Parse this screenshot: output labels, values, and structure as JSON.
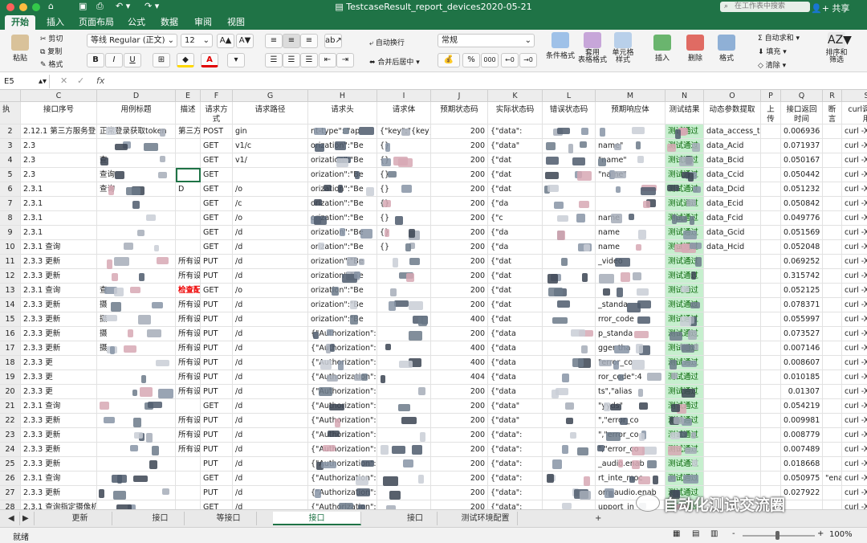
{
  "window": {
    "title": "TestcaseResult_report_devices2020-05-21",
    "search_placeholder": "在工作表中搜索",
    "share": "共享"
  },
  "ribbon_tabs": [
    "开始",
    "插入",
    "页面布局",
    "公式",
    "数据",
    "审阅",
    "视图"
  ],
  "ribbon": {
    "paste": "粘贴",
    "cut": "剪切",
    "copy": "复制",
    "format_painter": "格式",
    "font_name": "等线 Regular (正文)",
    "font_size": "12",
    "bold": "B",
    "italic": "I",
    "underline": "U",
    "wrap": "自动换行",
    "merge": "合并后居中",
    "number_format": "常规",
    "percent": "%",
    "comma": "000",
    "cond_format": "条件格式",
    "table_format": "套用\n表格格式",
    "cell_styles": "单元格\n样式",
    "insert": "插入",
    "delete": "删除",
    "format": "格式",
    "autosum": "自动求和",
    "fill": "填充",
    "clear": "清除",
    "sort_filter": "排序和\n筛选"
  },
  "formula_bar": {
    "name_box": "E5",
    "fx": "fx",
    "value": ""
  },
  "columns": [
    {
      "letter": "",
      "title": ""
    },
    {
      "letter": "C",
      "title": "接口序号"
    },
    {
      "letter": "D",
      "title": "用例标题"
    },
    {
      "letter": "E",
      "title": "描述"
    },
    {
      "letter": "F",
      "title": "请求方式"
    },
    {
      "letter": "G",
      "title": "请求路径"
    },
    {
      "letter": "H",
      "title": "请求头"
    },
    {
      "letter": "I",
      "title": "请求体"
    },
    {
      "letter": "J",
      "title": "预期状态码"
    },
    {
      "letter": "K",
      "title": "实际状态码"
    },
    {
      "letter": "L",
      "title": "错误状态码"
    },
    {
      "letter": "M",
      "title": "预期响应体"
    },
    {
      "letter": "N",
      "title": "测试结果"
    },
    {
      "letter": "O",
      "title": "动态参数提取"
    },
    {
      "letter": "P",
      "title": "上传下载文件"
    },
    {
      "letter": "Q",
      "title": "接口返回时间"
    },
    {
      "letter": "R",
      "title": "断言异常提示"
    },
    {
      "letter": "S",
      "title": "curl调试使用"
    }
  ],
  "first_header_cell": "执",
  "rows": [
    {
      "n": "2",
      "c": "2.12.1 第三方服务登录",
      "d": "正常登录获取token",
      "e": "第三方",
      "f": "POST",
      "g": "gin",
      "h": "nt-type\": \"ap",
      "i": "{\"key\":\"{key}\",\"se",
      "j": "200",
      "k": "{\"data\":",
      "l": "",
      "m": "",
      "nres": "测试通过",
      "o": "data_access_token",
      "q": "0.006936",
      "s": "curl -X POST -"
    },
    {
      "n": "3",
      "c": "2.3",
      "d": "",
      "e": "",
      "f": "GET",
      "g": "v1/c",
      "h": "orization\":\"Be",
      "i": "{}",
      "j": "200",
      "k": "{\"data\"",
      "m": "name\"",
      "nres": "测试通过",
      "o": "data_Acid",
      "q": "0.071937",
      "s": "curl -X GET -H"
    },
    {
      "n": "4",
      "c": "2.3",
      "d": "查",
      "e": "",
      "f": "GET",
      "g": "v1/",
      "h": "orization\":\"Be",
      "i": "{}",
      "j": "200",
      "k": "{\"dat",
      "m": "\"name\"",
      "nres": "测试通过",
      "o": "data_Bcid",
      "q": "0.050167",
      "s": "curl -X GET -H"
    },
    {
      "n": "5",
      "c": "2.3",
      "d": "查询",
      "e": "",
      "f": "GET",
      "g": "",
      "h": "orization\":\"Be",
      "i": "{}",
      "j": "200",
      "k": "{\"dat",
      "m": "\"name\"",
      "nres": "测试通过",
      "o": "data_Ccid",
      "q": "0.050442",
      "s": "curl -X GET -H"
    },
    {
      "n": "6",
      "c": "2.3.1",
      "d": "查询",
      "e": "D",
      "f": "GET",
      "g": "/o",
      "h": "orization\":\"Be",
      "i": "{}",
      "j": "200",
      "k": "{\"dat",
      "m": "",
      "nres": "测试通过",
      "o": "data_Dcid",
      "q": "0.051232",
      "s": "curl -X GET -H"
    },
    {
      "n": "7",
      "c": "2.3.1",
      "d": "",
      "e": "",
      "f": "GET",
      "g": "/c",
      "h": "orization\":\"Be",
      "i": "{}",
      "j": "200",
      "k": "{\"da",
      "m": "",
      "nres": "测试通过",
      "o": "data_Ecid",
      "q": "0.050842",
      "s": "curl -X GET -H"
    },
    {
      "n": "8",
      "c": "2.3.1",
      "d": "",
      "e": "",
      "f": "GET",
      "g": "/o",
      "h": "orization\":\"Be",
      "i": "{}",
      "j": "200",
      "k": "{\"c",
      "m": "name",
      "nres": "测试通过",
      "o": "data_Fcid",
      "q": "0.049776",
      "s": "curl -X GET -H"
    },
    {
      "n": "9",
      "c": "2.3.1",
      "d": "",
      "e": "",
      "f": "GET",
      "g": "/d",
      "h": "orization\":\"Be",
      "i": "{}",
      "j": "200",
      "k": "{\"da",
      "m": "name",
      "nres": "测试通过",
      "o": "data_Gcid",
      "q": "0.051569",
      "s": "curl -X GET -H"
    },
    {
      "n": "10",
      "c": "2.3.1 查询",
      "d": "",
      "e": "",
      "f": "GET",
      "g": "/d",
      "h": "orization\":\"Be",
      "i": "{}",
      "j": "200",
      "k": "{\"da",
      "m": "name",
      "nres": "测试通过",
      "o": "data_Hcid",
      "q": "0.052048",
      "s": "curl -X GET -H"
    },
    {
      "n": "11",
      "c": "2.3.3 更新",
      "d": "",
      "e": "所有设",
      "f": "PUT",
      "g": "/d",
      "h": "orization\":\"Be",
      "i": "",
      "j": "200",
      "k": "{\"dat",
      "m": "_video",
      "nres": "测试通过",
      "o": "",
      "q": "0.069252",
      "s": "curl -X PUT -H"
    },
    {
      "n": "12",
      "c": "2.3.3 更新",
      "d": "",
      "e": "所有设",
      "f": "PUT",
      "g": "/d",
      "h": "orization\":\"Be",
      "i": "",
      "j": "200",
      "k": "{\"dat",
      "m": "",
      "nres": "测试通过",
      "o": "",
      "q": "0.315742",
      "s": "curl -X PUT -H"
    },
    {
      "n": "13",
      "c": "2.3.1 查询",
      "d": "查",
      "e": "检查配置",
      "f": "GET",
      "g": "/o",
      "h": "orization\":\"Be",
      "i": "",
      "j": "200",
      "k": "{\"dat",
      "m": "",
      "nres": "测试通过",
      "o": "",
      "q": "0.052125",
      "s": "curl -X GET -H"
    },
    {
      "n": "14",
      "c": "2.3.3 更新",
      "d": "摄",
      "e": "所有设",
      "f": "PUT",
      "g": "/d",
      "h": "orization\":\"Be",
      "i": "",
      "j": "200",
      "k": "{\"dat",
      "m": "_standa",
      "nres": "测试通过",
      "o": "",
      "q": "0.078371",
      "s": "curl -X PUT -H"
    },
    {
      "n": "15",
      "c": "2.3.3 更新",
      "d": "摄",
      "e": "所有设",
      "f": "PUT",
      "g": "/d",
      "h": "orization\":\"Be",
      "i": "",
      "j": "400",
      "k": "{\"dat",
      "m": "rror_code",
      "nres": "测试通过",
      "o": "",
      "q": "0.055997",
      "s": "curl -X PUT -H"
    },
    {
      "n": "16",
      "c": "2.3.3 更新",
      "d": "摄",
      "e": "所有设",
      "f": "PUT",
      "g": "/d",
      "h": "{\"Authorization\":\"B",
      "i": "",
      "j": "200",
      "k": "{\"data",
      "m": "p_standa",
      "nres": "测试通过",
      "o": "",
      "q": "0.073527",
      "s": "curl -X PUT -H"
    },
    {
      "n": "17",
      "c": "2.3.3 更新",
      "d": "摄",
      "e": "所有设",
      "f": "PUT",
      "g": "/d",
      "h": "{\"Authorization\":\"B",
      "i": "",
      "j": "400",
      "k": "{\"data",
      "m": "gger tha",
      "nres": "测试通过",
      "o": "",
      "q": "0.007146",
      "s": "curl -X PUT -H"
    },
    {
      "n": "18",
      "c": "2.3.3 更",
      "d": "",
      "e": "所有设",
      "f": "PUT",
      "g": "/d",
      "h": "{\"Authorization\":\"B",
      "i": "",
      "j": "400",
      "k": "{\"data",
      "m": "\"error_co",
      "nres": "测试通过",
      "o": "",
      "q": "0.008607",
      "s": "curl -X PUT -H"
    },
    {
      "n": "19",
      "c": "2.3.3 更",
      "d": "",
      "e": "所有设",
      "f": "PUT",
      "g": "/d",
      "h": "{\"Authorization\":\"B",
      "i": "",
      "j": "404",
      "k": "{\"data",
      "m": "ror_code\":4",
      "nres": "测试通过",
      "o": "",
      "q": "0.010185",
      "s": "curl -X PUT -H"
    },
    {
      "n": "20",
      "c": "2.3.3 更",
      "d": "",
      "e": "所有设",
      "f": "PUT",
      "g": "/d",
      "h": "{\"Authorization\":\"B",
      "i": "",
      "j": "200",
      "k": "{\"data",
      "m": "ts\",\"alias",
      "nres": "测试通过",
      "o": "",
      "q": "0.01307",
      "s": "curl -X PUT -H"
    },
    {
      "n": "21",
      "c": "2.3.1 查询",
      "d": "",
      "e": "",
      "f": "GET",
      "g": "/d",
      "h": "{\"Authorization\":\"B",
      "i": "",
      "j": "200",
      "k": "{\"data\"",
      "m": "\"yyds\"",
      "nres": "测试通过",
      "o": "",
      "q": "0.054219",
      "s": "curl -X GET -H"
    },
    {
      "n": "22",
      "c": "2.3.3 更新",
      "d": "",
      "e": "所有设",
      "f": "PUT",
      "g": "/d",
      "h": "{\"Authorization\":\"B",
      "i": "",
      "j": "200",
      "k": "{\"data\"",
      "m": "\",\"error_co",
      "nres": "测试通过",
      "o": "",
      "q": "0.009981",
      "s": "curl -X PUT -H"
    },
    {
      "n": "23",
      "c": "2.3.3 更新",
      "d": "",
      "e": "所有设",
      "f": "PUT",
      "g": "/d",
      "h": "{\"Authorization\":\"B",
      "i": "",
      "j": "200",
      "k": "{\"data\":",
      "m": "\",\"error_co",
      "nres": "测试通过",
      "o": "",
      "q": "0.008779",
      "s": "curl -X PUT -H"
    },
    {
      "n": "24",
      "c": "2.3.3 更新",
      "d": "",
      "e": "所有设",
      "f": "PUT",
      "g": "/d",
      "h": "{\"Authorization\":\"B",
      "i": "",
      "j": "200",
      "k": "{\"data\":",
      "m": "\",\"error_co",
      "nres": "测试通过",
      "o": "",
      "q": "0.007489",
      "s": "curl -X PUT -H"
    },
    {
      "n": "25",
      "c": "2.3.3 更新",
      "d": "",
      "e": "",
      "f": "PUT",
      "g": "/d",
      "h": "{\"Authorization\":\"B",
      "i": "",
      "j": "200",
      "k": "{\"data\":",
      "m": "_audio.enab",
      "nres": "测试通过",
      "o": "",
      "q": "0.018668",
      "s": "curl -X PUT -H"
    },
    {
      "n": "26",
      "c": "2.3.1 查询",
      "d": "",
      "e": "",
      "f": "GET",
      "g": "/d",
      "h": "{\"Authorization\":\"B",
      "i": "",
      "j": "200",
      "k": "{\"data\":",
      "m": "rt_inte_moc",
      "nres": "测试通过",
      "o": "",
      "q": "0.050975",
      "r": "\"enab",
      "s": "curl -X GET -H"
    },
    {
      "n": "27",
      "c": "2.3.3 更新",
      "d": "",
      "e": "",
      "f": "PUT",
      "g": "/d",
      "h": "{\"Authorization\":\"B",
      "i": "",
      "j": "200",
      "k": "{\"data\":",
      "m": "om_audio.enab",
      "nres": "测试通过",
      "o": "",
      "q": "0.027922",
      "s": "curl -X PUT -H"
    },
    {
      "n": "28",
      "c": "2.3.1 查询指定摄像机",
      "d": "",
      "e": "",
      "f": "GET",
      "g": "/d",
      "h": "{\"Authorization\":\"B",
      "i": "",
      "j": "200",
      "k": "{\"data\":",
      "m": "upport_in",
      "nres": "测试通过",
      "o": "",
      "q": "",
      "s": "curl -X GET -H"
    }
  ],
  "sheet_tabs": [
    "更新",
    "接口",
    "等接口",
    "接口",
    "接口",
    "测试环境配置"
  ],
  "sheet_add": "+",
  "status": {
    "left": "就绪",
    "zoom": "100%",
    "zoom_minus": "-",
    "zoom_plus": "+"
  },
  "watermark": "自动化测试交流圈",
  "colors": {
    "excel_green": "#1f7346",
    "pass_fill": "#c6efce",
    "pass_text": "#006100"
  }
}
